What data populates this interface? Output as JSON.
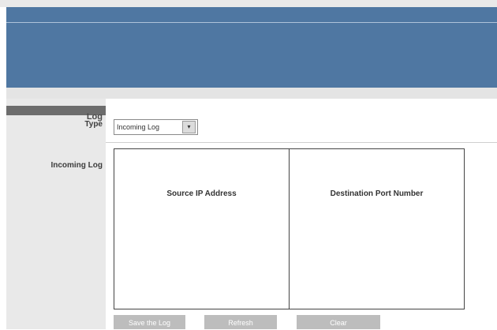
{
  "log": {
    "section_title": "Log",
    "type_label": "Type",
    "type_select": {
      "value": "Incoming Log",
      "arrow": "▾"
    },
    "log_label": "Incoming Log",
    "table": {
      "columns": [
        "Source IP Address",
        "Destination Port Number"
      ]
    },
    "buttons": {
      "save": "Save the Log",
      "refresh": "Refresh",
      "clear": "Clear"
    }
  },
  "colors": {
    "header": "#4f77a2",
    "section_bar": "#6d6d6d",
    "panel": "#e9e9e9",
    "button": "#bdbdbd"
  }
}
